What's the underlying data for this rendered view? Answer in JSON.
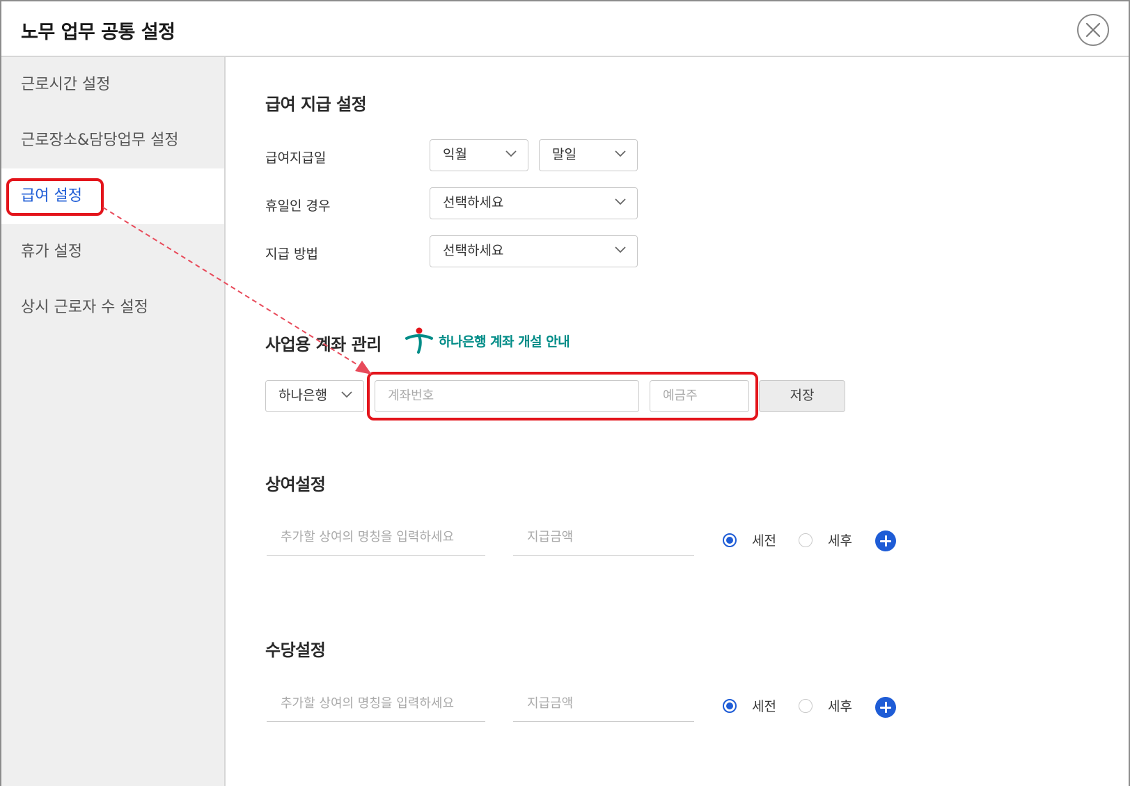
{
  "window": {
    "title": "노무 업무 공통 설정",
    "close_icon": "close-circle-icon"
  },
  "sidebar": {
    "items": [
      {
        "label": "근로시간 설정",
        "active": false
      },
      {
        "label": "근로장소&담당업무 설정",
        "active": false
      },
      {
        "label": "급여 설정",
        "active": true
      },
      {
        "label": "휴가 설정",
        "active": false
      },
      {
        "label": "상시 근로자 수 설정",
        "active": false
      }
    ]
  },
  "payment": {
    "title": "급여 지급 설정",
    "pay_day_label": "급여지급일",
    "pay_month_value": "익월",
    "pay_day_value": "말일",
    "holiday_label": "휴일인 경우",
    "holiday_value": "선택하세요",
    "method_label": "지급 방법",
    "method_value": "선택하세요"
  },
  "account": {
    "title": "사업용 계좌 관리",
    "hana_link": "하나은행 계좌 개설 안내",
    "bank_value": "하나은행",
    "account_placeholder": "계좌번호",
    "holder_placeholder": "예금주",
    "save_label": "저장"
  },
  "bonus": {
    "title": "상여설정",
    "name_placeholder": "추가할 상여의 명칭을 입력하세요",
    "amount_placeholder": "지급금액",
    "pretax_label": "세전",
    "aftertax_label": "세후",
    "selected": "세전"
  },
  "allowance": {
    "title": "수당설정",
    "name_placeholder": "추가할 상여의 명칭을 입력하세요",
    "amount_placeholder": "지급금액",
    "pretax_label": "세전",
    "aftertax_label": "세후",
    "selected": "세전"
  },
  "colors": {
    "accent": "#1e5cd6",
    "highlight": "#e3141b",
    "hana": "#008c87"
  }
}
